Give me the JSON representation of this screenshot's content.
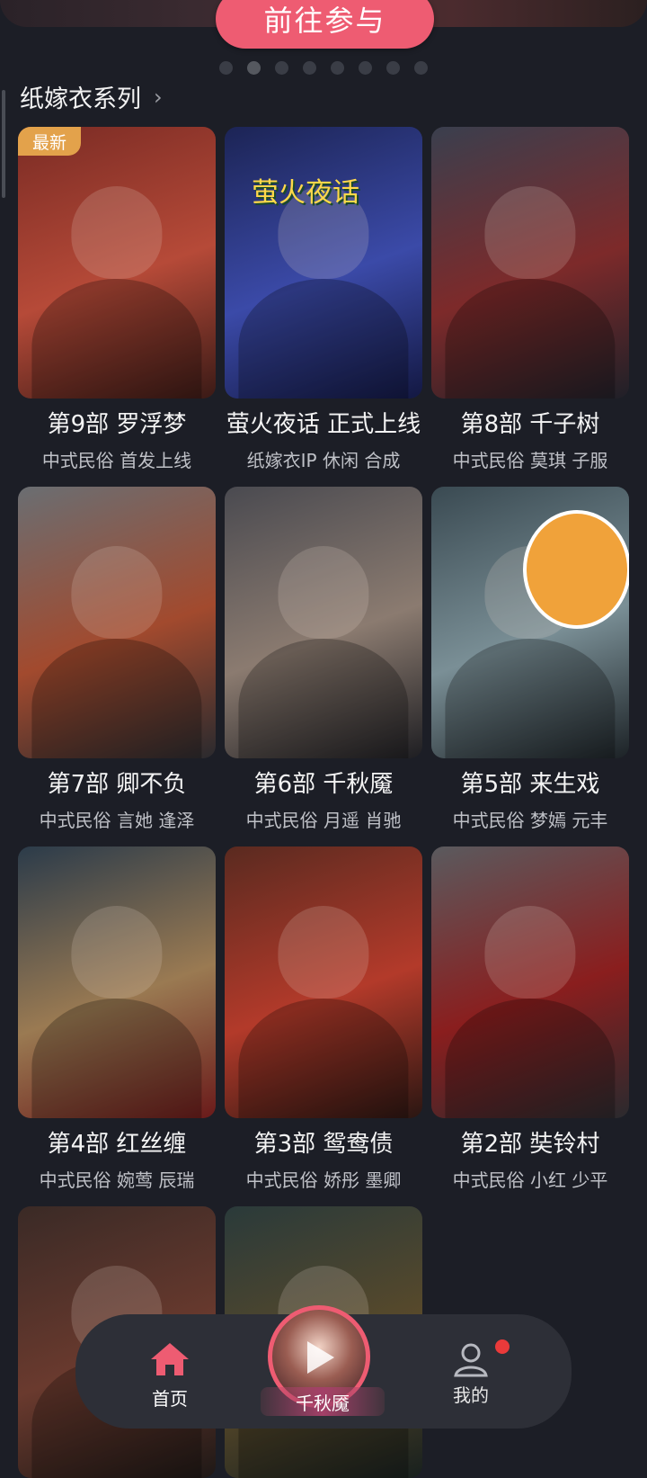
{
  "header": {
    "join_label": "前往参与"
  },
  "section": {
    "title": "纸嫁衣系列",
    "chevron": "›"
  },
  "badge": "最新",
  "game_logo_text": "萤火夜话",
  "cards": [
    {
      "title": "第9部 罗浮梦",
      "sub": "中式民俗 首发上线",
      "colors": [
        "#7a2b24",
        "#b64a38",
        "#3a1a16"
      ]
    },
    {
      "title": "萤火夜话 正式上线",
      "sub": "纸嫁衣IP 休闲 合成",
      "colors": [
        "#1c2455",
        "#3b4aa8",
        "#131842"
      ]
    },
    {
      "title": "第8部 千子树",
      "sub": "中式民俗  莫琪 子服",
      "colors": [
        "#3a3f4e",
        "#7d2a2a",
        "#1f2028"
      ]
    },
    {
      "title": "第7部 卿不负",
      "sub": "中式民俗 言她 逢泽",
      "colors": [
        "#6a6e72",
        "#a24a2e",
        "#2a2a2e"
      ]
    },
    {
      "title": "第6部 千秋魇",
      "sub": "中式民俗 月遥 肖驰",
      "colors": [
        "#4a4a50",
        "#8b7b70",
        "#1e1e22"
      ]
    },
    {
      "title": "第5部 来生戏",
      "sub": "中式民俗 梦嫣 元丰",
      "colors": [
        "#3a4a52",
        "#7a8f96",
        "#1c2226"
      ]
    },
    {
      "title": "第4部 红丝缠",
      "sub": "中式民俗 婉莺 辰瑞",
      "colors": [
        "#2b3b4a",
        "#9a7a52",
        "#6a1a1a"
      ]
    },
    {
      "title": "第3部 鸳鸯债",
      "sub": "中式民俗 娇彤 墨卿",
      "colors": [
        "#5a2a20",
        "#b33a2a",
        "#2a1612"
      ]
    },
    {
      "title": "第2部 奘铃村",
      "sub": "中式民俗 小红 少平",
      "colors": [
        "#5a5a5e",
        "#8a1e1e",
        "#2a2a2e"
      ]
    },
    {
      "title": "",
      "sub": "",
      "colors": [
        "#3a2a26",
        "#6a3a2e",
        "#1e1816"
      ]
    },
    {
      "title": "",
      "sub": "",
      "colors": [
        "#2a3a3a",
        "#5a4a2a",
        "#18201e"
      ]
    }
  ],
  "nav": {
    "home": "首页",
    "center": "千秋魇",
    "mine": "我的"
  }
}
